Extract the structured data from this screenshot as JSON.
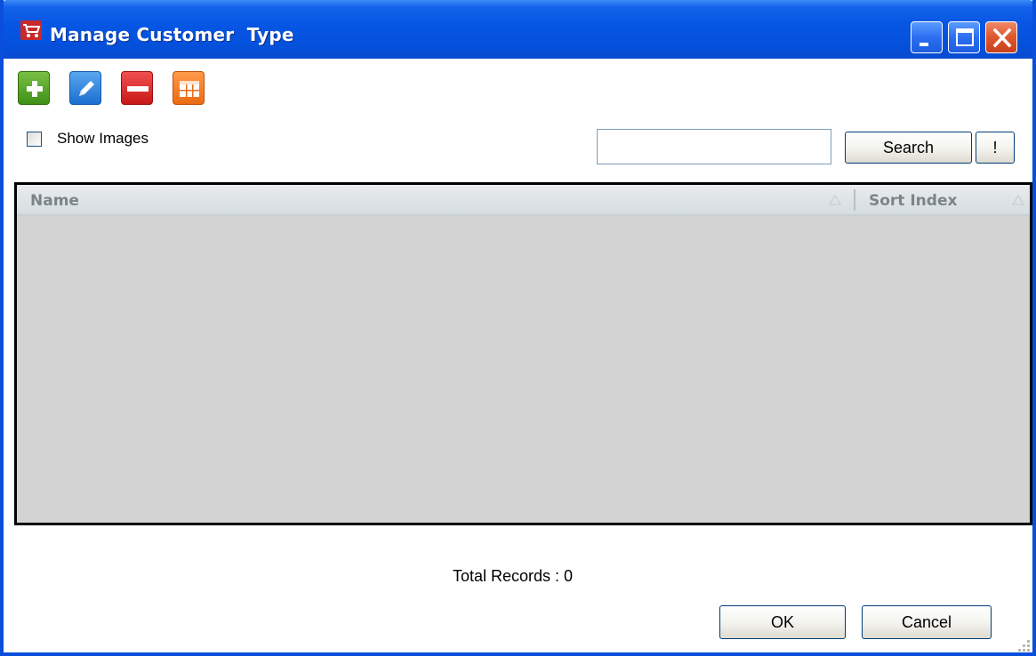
{
  "window": {
    "title": "Manage Customer  Type",
    "title_icon": "shopping-cart-icon"
  },
  "caption_buttons": {
    "minimize_icon": "minimize-icon",
    "maximize_icon": "maximize-icon",
    "close_icon": "close-icon"
  },
  "toolbar": {
    "buttons": [
      {
        "icon": "add-icon",
        "color": "#4fa526"
      },
      {
        "icon": "edit-pencil-icon",
        "color": "#2a82de"
      },
      {
        "icon": "remove-icon",
        "color": "#dd2a2a"
      },
      {
        "icon": "grid-columns-icon",
        "color": "#f47c26"
      }
    ]
  },
  "options": {
    "show_images_label": "Show Images",
    "show_images_checked": false
  },
  "search": {
    "value": "",
    "button_label": "Search",
    "bang_label": "!"
  },
  "grid": {
    "columns": [
      {
        "label": "Name",
        "sort_icon": "sort-asc-icon"
      },
      {
        "label": "Sort Index",
        "sort_icon": "sort-asc-icon"
      }
    ],
    "rows": []
  },
  "footer": {
    "total_records": "Total Records : 0",
    "ok_label": "OK",
    "cancel_label": "Cancel",
    "resize_grip_icon": "resize-grip-icon"
  },
  "colors": {
    "titlebar": "#0756e4",
    "grid_background": "#d3d3d3",
    "grid_header": "#dde3e5"
  }
}
